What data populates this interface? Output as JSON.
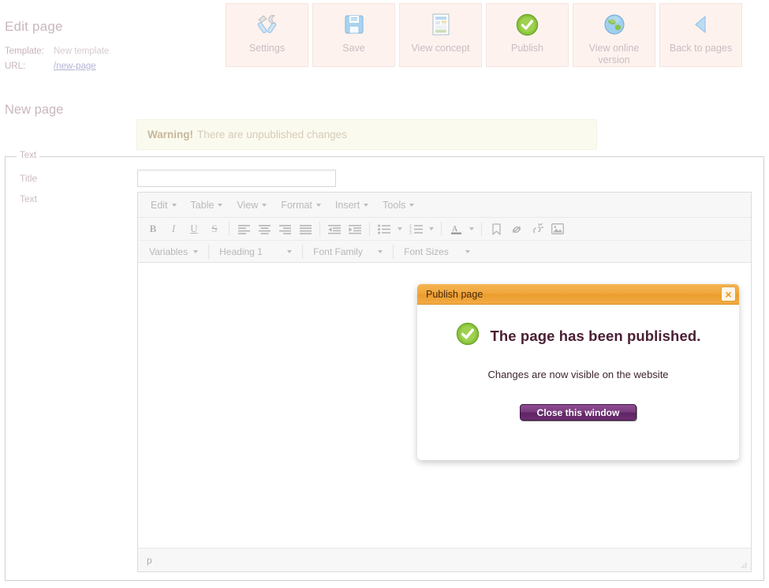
{
  "header": {
    "title": "Edit page",
    "template_label": "Template:",
    "template_value": "New template",
    "url_label": "URL:",
    "url_value": "/new-page"
  },
  "toolbar": {
    "buttons": [
      {
        "label": "Settings",
        "icon": "tools-icon"
      },
      {
        "label": "Save",
        "icon": "floppy-disk-icon"
      },
      {
        "label": "View concept",
        "icon": "document-preview-icon"
      },
      {
        "label": "Publish",
        "icon": "green-check-circle-icon"
      },
      {
        "label": "View online version",
        "icon": "globe-icon"
      },
      {
        "label": "Back to pages",
        "icon": "back-arrow-icon"
      }
    ]
  },
  "page": {
    "doc_title": "New page",
    "warning_strong": "Warning!",
    "warning_text": "There are unpublished changes"
  },
  "form": {
    "legend": "Text",
    "title_label": "Title",
    "title_value": "",
    "title_placeholder": "",
    "text_label": "Text"
  },
  "editor": {
    "menus": [
      "Edit",
      "Table",
      "View",
      "Format",
      "Insert",
      "Tools"
    ],
    "format_buttons": [
      {
        "name": "bold-icon",
        "glyph": "B"
      },
      {
        "name": "italic-icon",
        "glyph": "I"
      },
      {
        "name": "underline-icon",
        "glyph": "U"
      },
      {
        "name": "strikethrough-icon",
        "glyph": "S"
      },
      {
        "name": "align-left-icon"
      },
      {
        "name": "align-center-icon"
      },
      {
        "name": "align-right-icon"
      },
      {
        "name": "align-justify-icon"
      },
      {
        "name": "outdent-icon"
      },
      {
        "name": "indent-icon"
      },
      {
        "name": "bullet-list-icon"
      },
      {
        "name": "numbered-list-icon"
      },
      {
        "name": "text-color-icon"
      },
      {
        "name": "anchor-icon"
      },
      {
        "name": "link-icon"
      },
      {
        "name": "unlink-icon"
      },
      {
        "name": "image-icon"
      }
    ],
    "combos": [
      {
        "label": "Variables"
      },
      {
        "label": "Heading 1"
      },
      {
        "label": "Font Family"
      },
      {
        "label": "Font Sizes"
      }
    ],
    "content": "",
    "statusbar_path": "p"
  },
  "modal": {
    "title": "Publish page",
    "close_glyph": "×",
    "heading": "The page has been published.",
    "subtext": "Changes are now visible on the website",
    "button_label": "Close this window",
    "icon": "green-check-circle-icon"
  },
  "colors": {
    "toolbar_bg": "#fdf2ee",
    "modal_accent": "#f0a63c",
    "button_purple": "#7b3d80",
    "success_green": "#7cba2b",
    "warning_bg": "#fbfaee"
  }
}
